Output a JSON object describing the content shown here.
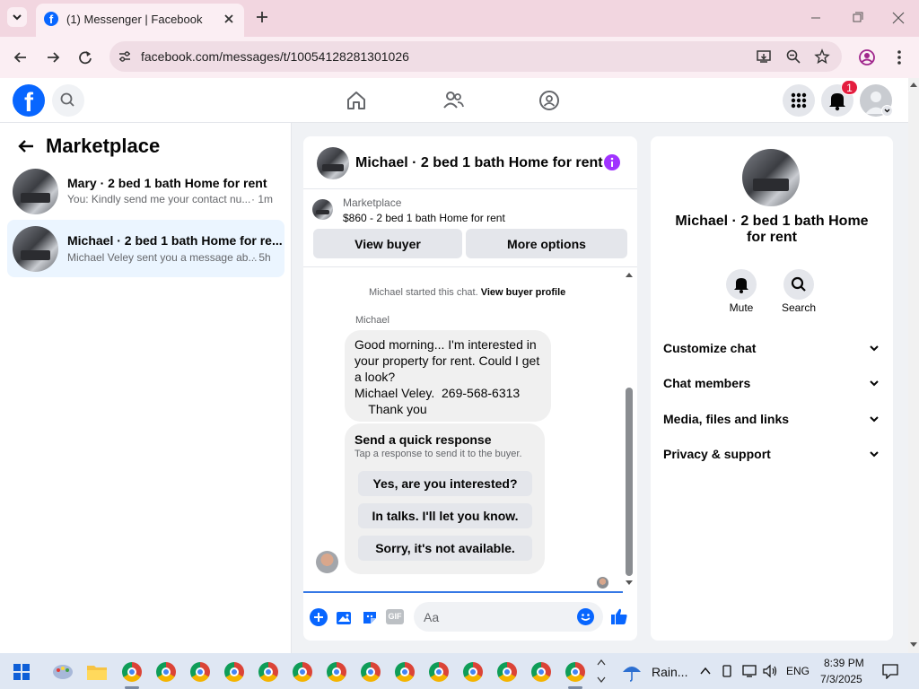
{
  "browser": {
    "tab_title": "(1) Messenger | Facebook",
    "url": "facebook.com/messages/t/10054128281301026"
  },
  "fb": {
    "notification_count": "1"
  },
  "left": {
    "title": "Marketplace",
    "threads": [
      {
        "name": "Mary · 2 bed 1 bath Home for rent",
        "preview": "You: Kindly send me your contact nu...",
        "time": "· 1m"
      },
      {
        "name": "Michael · 2 bed 1 bath Home for re...",
        "preview": "Michael Veley sent you a message ab...",
        "time": "· 5h"
      }
    ]
  },
  "chat": {
    "header_name": "Michael · 2 bed 1 bath Home for rent",
    "listing_source": "Marketplace",
    "listing_title": "$860 - 2 bed 1 bath Home for rent",
    "view_buyer": "View buyer",
    "more_options": "More options",
    "started_text": "Michael started this chat.",
    "view_profile": "View buyer profile",
    "sender": "Michael",
    "message_lines": [
      "Good morning... I'm interested in",
      "your property for rent. Could I get",
      "a look?",
      "Michael Veley.  269-568-6313",
      "    Thank you"
    ],
    "quick_title": "Send a quick response",
    "quick_subtitle": "Tap a response to send it to the buyer.",
    "quick_replies": [
      "Yes, are you interested?",
      "In talks. I'll let you know.",
      "Sorry, it's not available."
    ],
    "input_placeholder": "Aa",
    "gif_label": "GIF"
  },
  "info": {
    "name_line1": "Michael · 2 bed 1 bath Home",
    "name_line2": "for rent",
    "mute": "Mute",
    "search": "Search",
    "sections": [
      "Customize chat",
      "Chat members",
      "Media, files and links",
      "Privacy & support"
    ]
  },
  "taskbar": {
    "weather": "Rain...",
    "lang": "ENG",
    "time": "8:39 PM",
    "date": "7/3/2025"
  },
  "colors": {
    "fb_blue": "#0866ff",
    "messenger_purple": "#a033ff",
    "notif_red": "#e41e3f"
  }
}
